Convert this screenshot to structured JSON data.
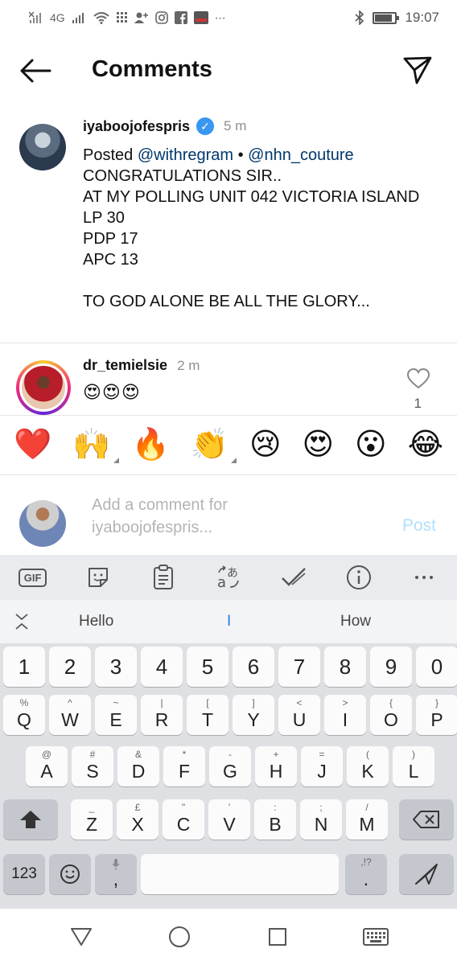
{
  "status_bar": {
    "network_left": "4G",
    "time": "19:07"
  },
  "header": {
    "title": "Comments"
  },
  "caption": {
    "username": "iyaboojofespris",
    "time": "5 m",
    "posted_prefix": "Posted ",
    "mention1": "@withregram",
    "separator": " • ",
    "mention2": "@nhn_couture",
    "body": "CONGRATULATIONS SIR..\nAT MY POLLING UNIT 042 VICTORIA ISLAND\nLP 30\nPDP 17\nAPC 13\n\nTO GOD ALONE BE ALL THE GLORY..."
  },
  "comment": {
    "username": "dr_temielsie",
    "time": "2 m",
    "text": "😍😍😍",
    "likes": "1"
  },
  "reactions": [
    "❤️",
    "🙌",
    "🔥",
    "👏",
    "😢",
    "😍",
    "😮",
    "😂"
  ],
  "add_comment": {
    "placeholder": "Add a comment for iyaboojofespris...",
    "post_label": "Post"
  },
  "keyboard": {
    "tools": [
      "GIF"
    ],
    "suggestions": [
      "Hello",
      "I",
      "How"
    ],
    "number_row": [
      "1",
      "2",
      "3",
      "4",
      "5",
      "6",
      "7",
      "8",
      "9",
      "0"
    ],
    "row1": [
      {
        "k": "Q",
        "h": "%"
      },
      {
        "k": "W",
        "h": "^"
      },
      {
        "k": "E",
        "h": "~"
      },
      {
        "k": "R",
        "h": "|"
      },
      {
        "k": "T",
        "h": "["
      },
      {
        "k": "Y",
        "h": "]"
      },
      {
        "k": "U",
        "h": "<"
      },
      {
        "k": "I",
        "h": ">"
      },
      {
        "k": "O",
        "h": "{"
      },
      {
        "k": "P",
        "h": "}"
      }
    ],
    "row2": [
      {
        "k": "A",
        "h": "@"
      },
      {
        "k": "S",
        "h": "#"
      },
      {
        "k": "D",
        "h": "&"
      },
      {
        "k": "F",
        "h": "*"
      },
      {
        "k": "G",
        "h": "-"
      },
      {
        "k": "H",
        "h": "+"
      },
      {
        "k": "J",
        "h": "="
      },
      {
        "k": "K",
        "h": "("
      },
      {
        "k": "L",
        "h": ")"
      }
    ],
    "row3": [
      {
        "k": "Z",
        "h": "_"
      },
      {
        "k": "X",
        "h": "£"
      },
      {
        "k": "C",
        "h": "\""
      },
      {
        "k": "V",
        "h": "'"
      },
      {
        "k": "B",
        "h": ":"
      },
      {
        "k": "N",
        "h": ";"
      },
      {
        "k": "M",
        "h": "/"
      }
    ],
    "sym_label": "123",
    "comma": ",",
    "period": ".",
    "period_hint": ",!?"
  },
  "colors": {
    "link": "#00376b",
    "verified": "#3897f0",
    "post_disabled": "#b2dffc",
    "placeholder": "#b4b4b4"
  }
}
